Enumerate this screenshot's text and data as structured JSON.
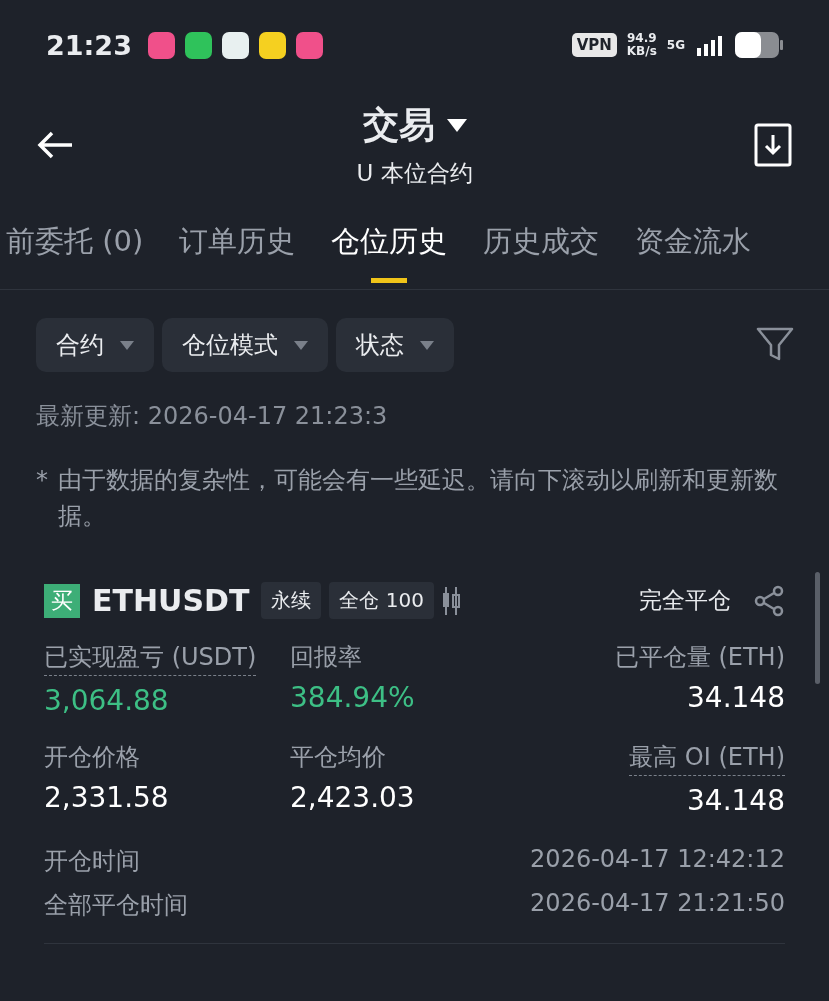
{
  "status_bar": {
    "time": "21:23",
    "app_icons": [
      {
        "color": "#f0508a"
      },
      {
        "color": "#2fc25b"
      },
      {
        "color": "#e8f0f0"
      },
      {
        "color": "#f5d020"
      },
      {
        "color": "#f0508a"
      }
    ],
    "vpn": "VPN",
    "speed": "94.9",
    "speed_unit": "KB/s",
    "network": "5G"
  },
  "header": {
    "title": "交易",
    "subtitle": "U 本位合约"
  },
  "tabs": [
    {
      "label": "前委托 (0)",
      "selected": false
    },
    {
      "label": "订单历史",
      "selected": false
    },
    {
      "label": "仓位历史",
      "selected": true
    },
    {
      "label": "历史成交",
      "selected": false
    },
    {
      "label": "资金流水",
      "selected": false
    }
  ],
  "filters": [
    "合约",
    "仓位模式",
    "状态"
  ],
  "updated": "最新更新: 2026-04-17 21:23:3",
  "note_mark": "*",
  "note": "由于数据的复杂性，可能会有一些延迟。请向下滚动以刷新和更新数据。",
  "position": {
    "side": "买",
    "symbol": "ETHUSDT",
    "tags": [
      "永续",
      "全仓 100"
    ],
    "status": "完全平仓",
    "stats": [
      {
        "label": "已实现盈亏 (USDT)",
        "value": "3,064.88",
        "positive": true,
        "underlined": true
      },
      {
        "label": "回报率",
        "value": "384.94%",
        "positive": true,
        "underlined": false
      },
      {
        "label": "已平仓量 (ETH)",
        "value": "34.148",
        "positive": false,
        "underlined": false
      },
      {
        "label": "开仓价格",
        "value": "2,331.58",
        "positive": false,
        "underlined": false
      },
      {
        "label": "平仓均价",
        "value": "2,423.03",
        "positive": false,
        "underlined": false
      },
      {
        "label": "最高 OI (ETH)",
        "value": "34.148",
        "positive": false,
        "underlined": true
      }
    ],
    "times": [
      {
        "label": "开仓时间",
        "value": "2026-04-17 12:42:12"
      },
      {
        "label": "全部平仓时间",
        "value": "2026-04-17 21:21:50"
      }
    ]
  }
}
